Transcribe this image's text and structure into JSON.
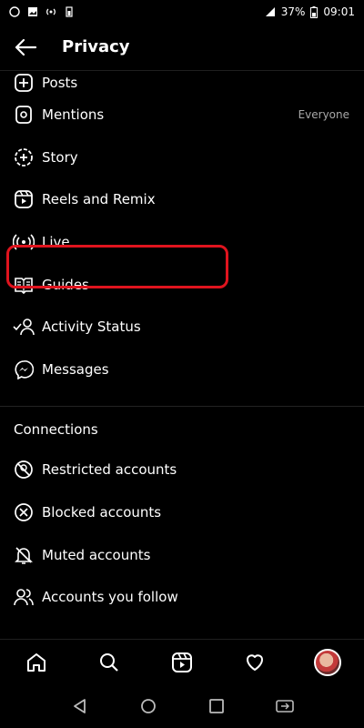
{
  "status_bar": {
    "battery": "37%",
    "time": "09:01"
  },
  "header": {
    "title": "Privacy"
  },
  "items": [
    {
      "label": "Posts",
      "icon": "plus-square-icon"
    },
    {
      "label": "Mentions",
      "icon": "at-icon",
      "value": "Everyone"
    },
    {
      "label": "Story",
      "icon": "story-add-icon"
    },
    {
      "label": "Reels and Remix",
      "icon": "reels-icon"
    },
    {
      "label": "Live",
      "icon": "live-icon"
    },
    {
      "label": "Guides",
      "icon": "guides-icon"
    },
    {
      "label": "Activity Status",
      "icon": "activity-status-icon"
    },
    {
      "label": "Messages",
      "icon": "messenger-icon"
    }
  ],
  "connections": {
    "title": "Connections",
    "items": [
      {
        "label": "Restricted accounts",
        "icon": "restricted-icon"
      },
      {
        "label": "Blocked accounts",
        "icon": "blocked-icon"
      },
      {
        "label": "Muted accounts",
        "icon": "muted-icon"
      },
      {
        "label": "Accounts you follow",
        "icon": "accounts-follow-icon"
      }
    ]
  },
  "highlight_color": "#e0141e"
}
